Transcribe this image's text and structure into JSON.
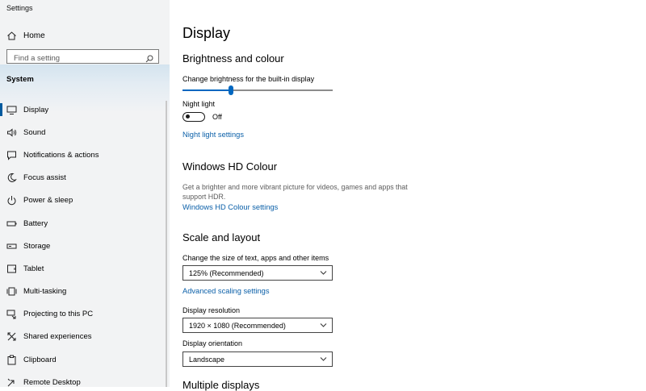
{
  "app": {
    "title": "Settings"
  },
  "sidebar": {
    "home_label": "Home",
    "search_placeholder": "Find a setting",
    "group_label": "System",
    "items": [
      {
        "label": "Display",
        "icon": "monitor-icon",
        "active": true
      },
      {
        "label": "Sound",
        "icon": "speaker-icon"
      },
      {
        "label": "Notifications & actions",
        "icon": "notification-icon"
      },
      {
        "label": "Focus assist",
        "icon": "moon-icon"
      },
      {
        "label": "Power & sleep",
        "icon": "power-icon"
      },
      {
        "label": "Battery",
        "icon": "battery-icon"
      },
      {
        "label": "Storage",
        "icon": "storage-icon"
      },
      {
        "label": "Tablet",
        "icon": "tablet-icon"
      },
      {
        "label": "Multi-tasking",
        "icon": "multitasking-icon"
      },
      {
        "label": "Projecting to this PC",
        "icon": "projector-icon"
      },
      {
        "label": "Shared experiences",
        "icon": "shared-icon"
      },
      {
        "label": "Clipboard",
        "icon": "clipboard-icon"
      },
      {
        "label": "Remote Desktop",
        "icon": "remote-icon"
      }
    ]
  },
  "main": {
    "title": "Display",
    "brightness": {
      "heading": "Brightness and colour",
      "slider_label": "Change brightness for the built-in display",
      "level": 0.32
    },
    "night_light": {
      "label": "Night light",
      "state": "Off",
      "settings_link": "Night light settings"
    },
    "hdr": {
      "heading": "Windows HD Colour",
      "description": "Get a brighter and more vibrant picture for videos, games and apps that support HDR.",
      "settings_link": "Windows HD Colour settings"
    },
    "scale": {
      "heading": "Scale and layout",
      "size_label": "Change the size of text, apps and other items",
      "size_value": "125% (Recommended)",
      "advanced_link": "Advanced scaling settings",
      "resolution_label": "Display resolution",
      "resolution_value": "1920 × 1080 (Recommended)",
      "orientation_label": "Display orientation",
      "orientation_value": "Landscape"
    },
    "multiple_displays": {
      "heading": "Multiple displays"
    }
  },
  "colors": {
    "accent": "#0067c0",
    "link": "#0a5fa8",
    "sidebar_bg": "#f2f3f4"
  }
}
